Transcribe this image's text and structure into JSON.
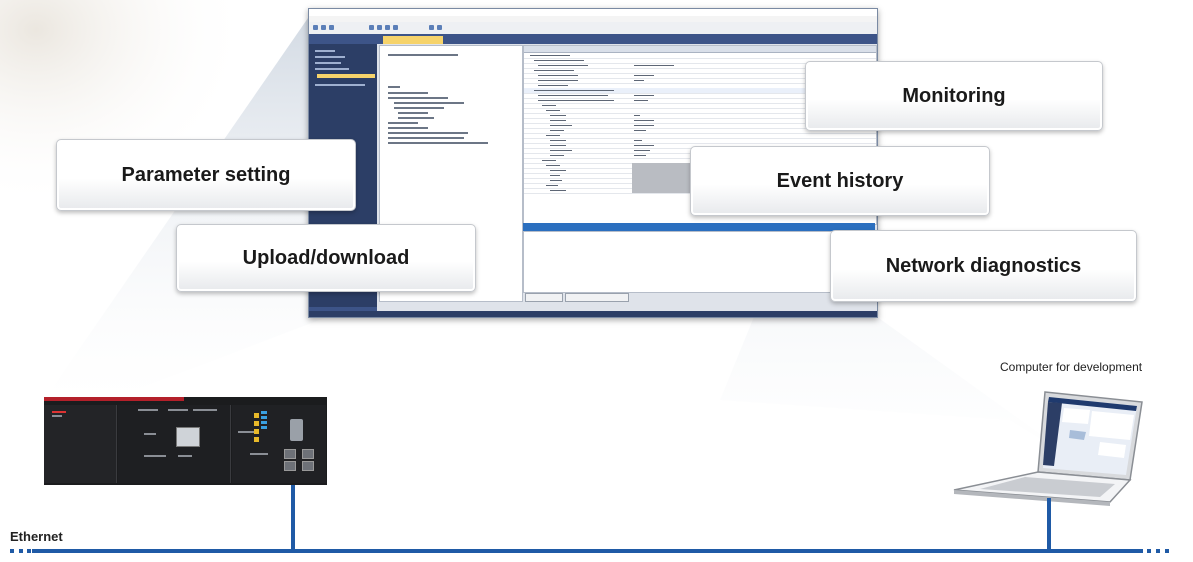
{
  "callouts": {
    "parameter_setting": "Parameter setting",
    "upload_download": "Upload/download",
    "monitoring": "Monitoring",
    "event_history": "Event history",
    "network_diagnostics": "Network diagnostics"
  },
  "labels": {
    "computer": "Computer for development",
    "ethernet": "Ethernet"
  },
  "colors": {
    "ethernet_line": "#1f5aa6",
    "beam": "#d6dde6",
    "accent": "#2b6fbf"
  }
}
